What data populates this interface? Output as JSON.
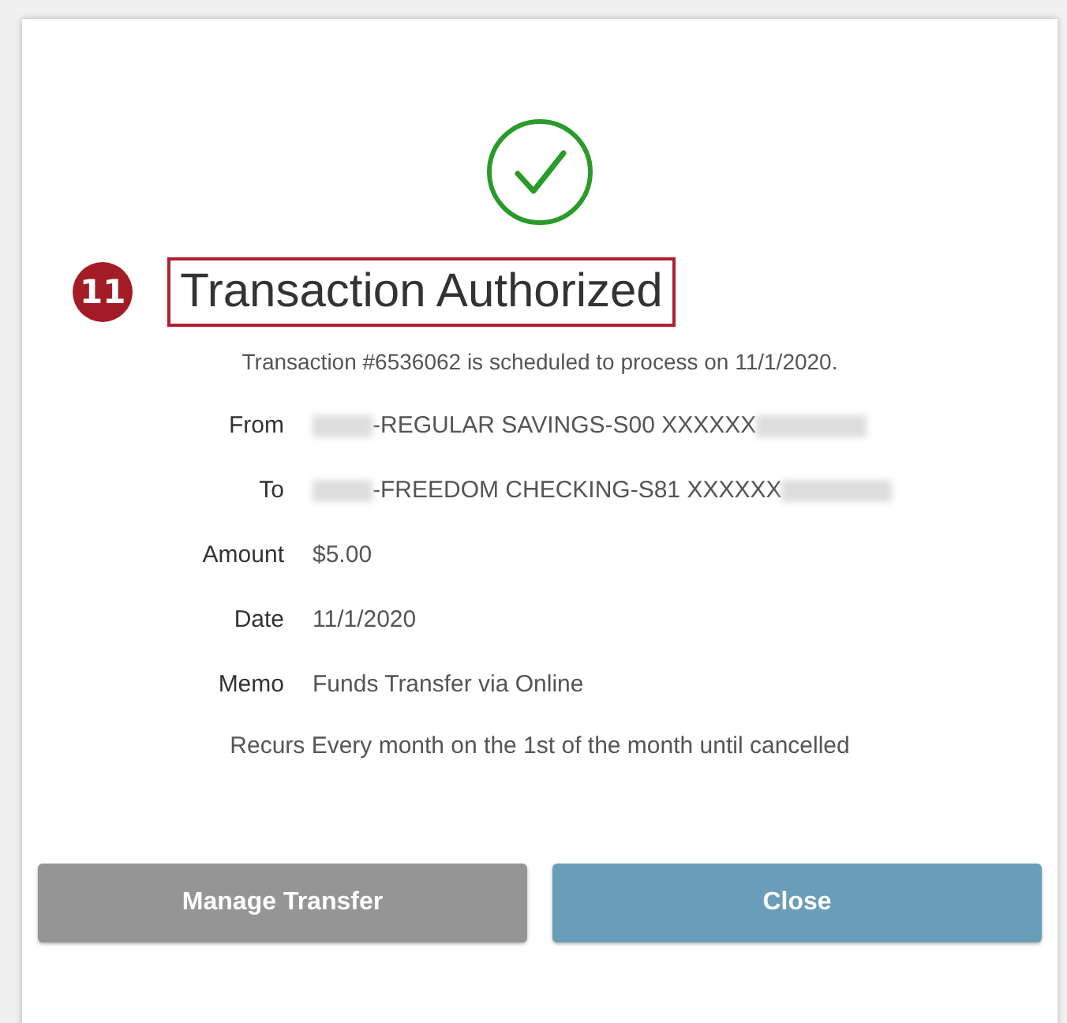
{
  "callout": {
    "number": "11"
  },
  "title": "Transaction Authorized",
  "subtitle": "Transaction #6536062 is scheduled to process on 11/1/2020.",
  "details": [
    {
      "label": "From",
      "value": "-REGULAR SAVINGS-S00 XXXXXX",
      "redacted": true
    },
    {
      "label": "To",
      "value": "-FREEDOM CHECKING-S81 XXXXXX",
      "redacted": true
    },
    {
      "label": "Amount",
      "value": "$5.00",
      "redacted": false
    },
    {
      "label": "Date",
      "value": "11/1/2020",
      "redacted": false
    },
    {
      "label": "Memo",
      "value": "Funds Transfer via Online",
      "redacted": false
    }
  ],
  "recurrence": "Recurs Every month on the 1st of the month until cancelled",
  "buttons": [
    {
      "label": "Manage Transfer",
      "kind": "secondary"
    },
    {
      "label": "Close",
      "kind": "primary"
    }
  ]
}
